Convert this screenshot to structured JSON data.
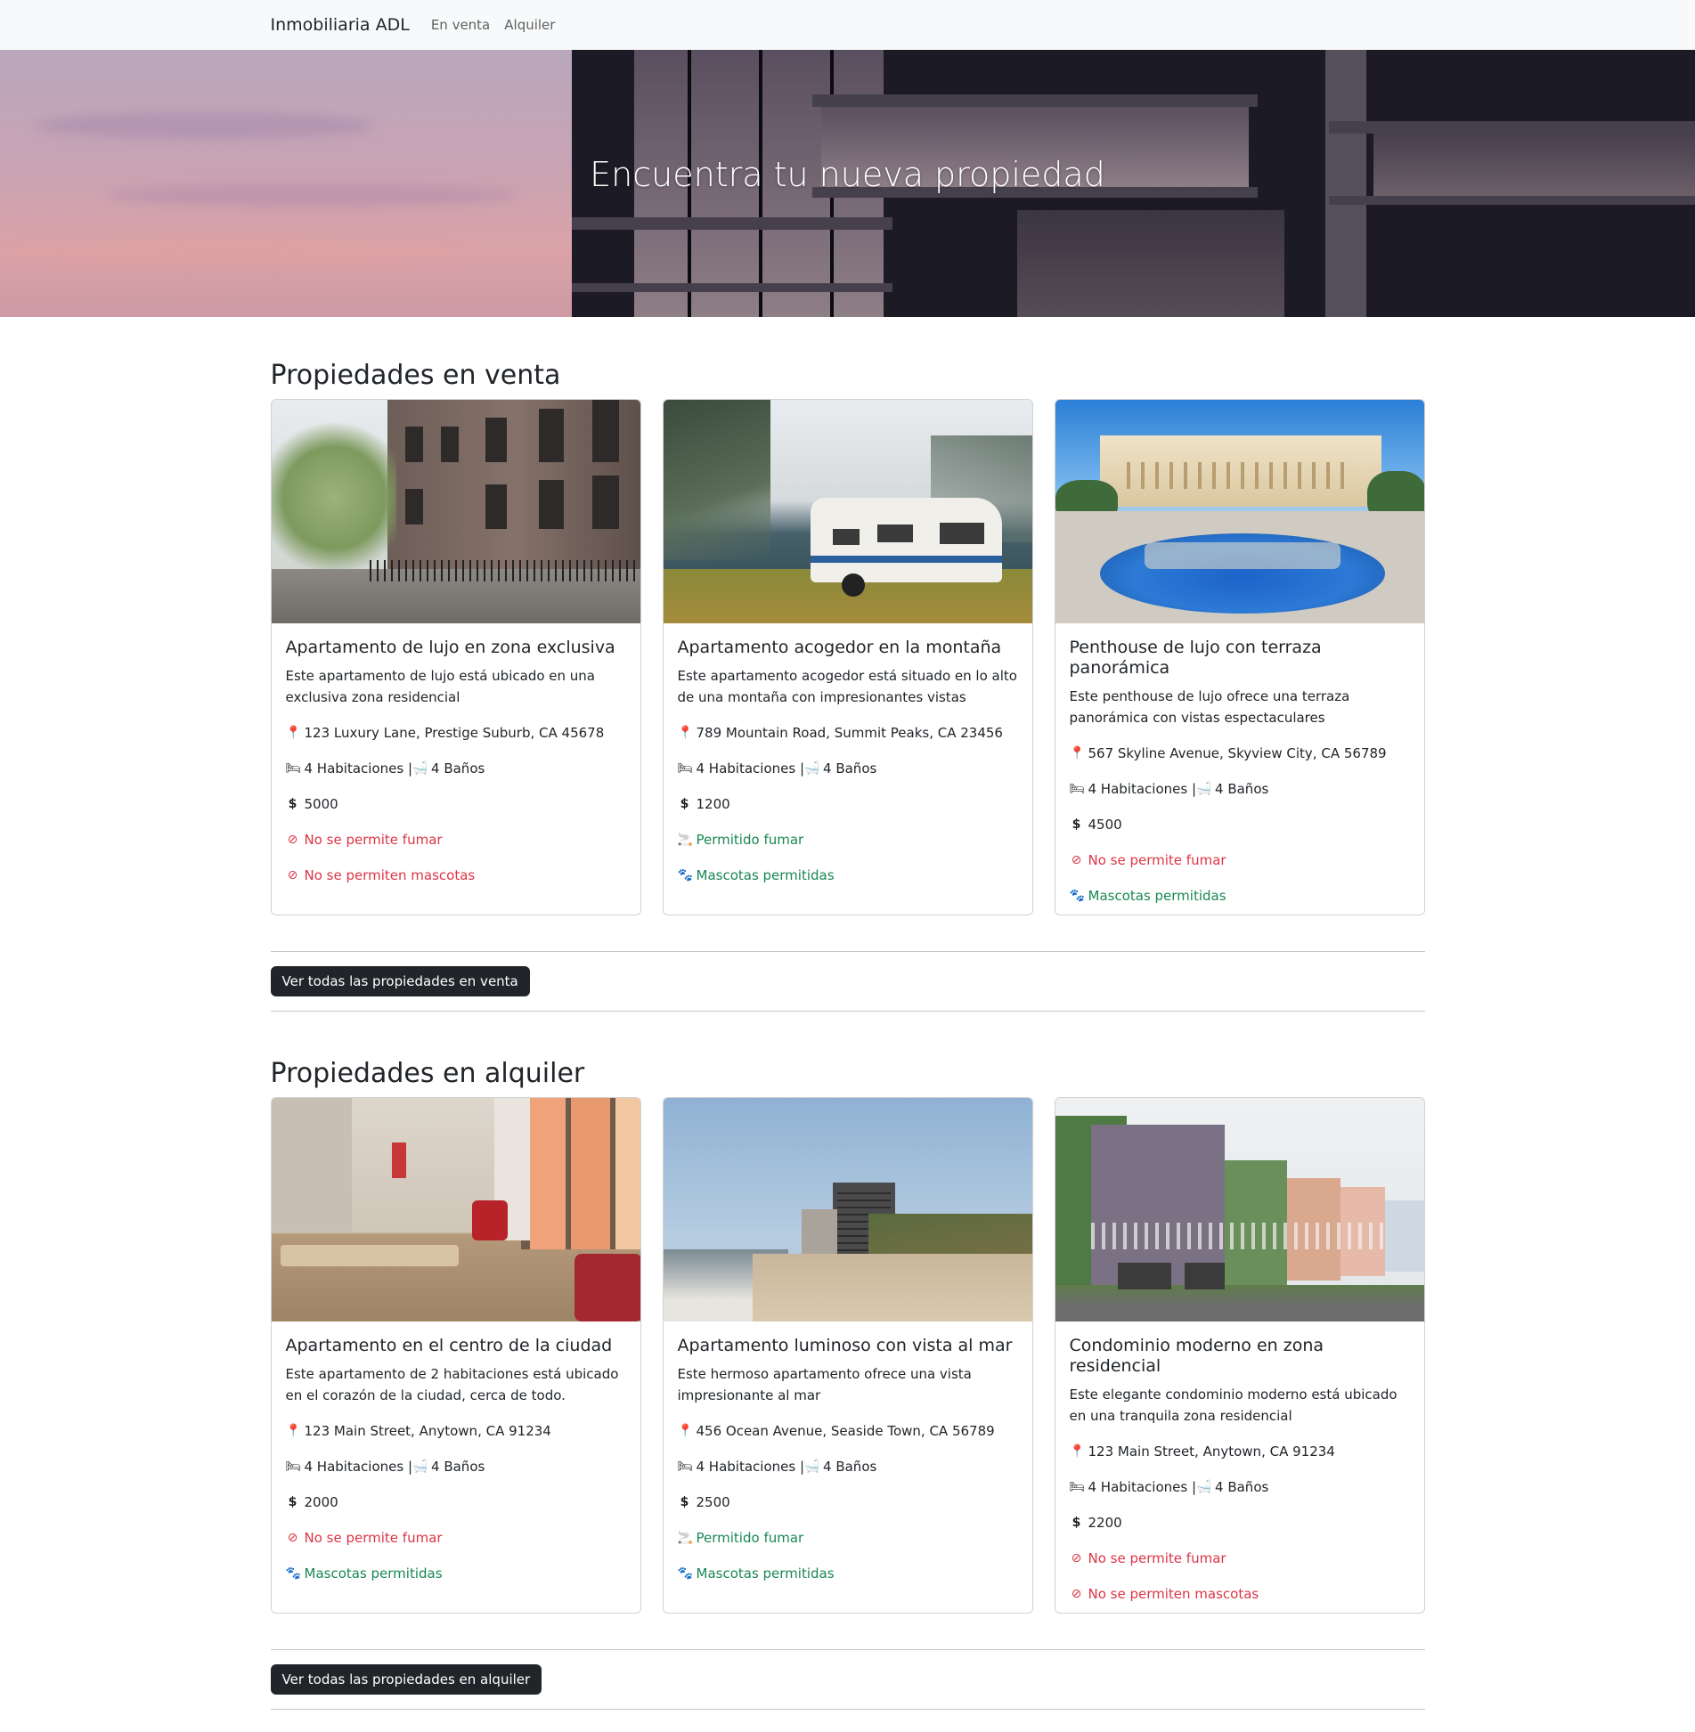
{
  "navbar": {
    "brand": "Inmobiliaria ADL",
    "links": [
      "En venta",
      "Alquiler"
    ]
  },
  "hero": {
    "title": "Encuentra tu nueva propiedad"
  },
  "colors": {
    "danger": "#dc3545",
    "success": "#198754",
    "button_dark": "#212529",
    "navbar_bg": "#f8f9fa"
  },
  "sale": {
    "heading": "Propiedades en venta",
    "button": "Ver todas las propiedades en venta",
    "cards": [
      {
        "title": "Apartamento de lujo en zona exclusiva",
        "description": "Este apartamento de lujo está ubicado en una exclusiva zona residencial",
        "address": "123 Luxury Lane, Prestige Suburb, CA 45678",
        "rooms": "4 Habitaciones | ",
        "baths": "4 Baños",
        "price": "5000",
        "smoking": "No se permite fumar",
        "pets": "No se permiten mascotas",
        "smoking_allowed": false,
        "pets_allowed": false,
        "image_icon": "brownstone-street-photo"
      },
      {
        "title": "Apartamento acogedor en la montaña",
        "description": "Este apartamento acogedor está situado en lo alto de una montaña con impresionantes vistas",
        "address": "789 Mountain Road, Summit Peaks, CA 23456",
        "rooms": "4 Habitaciones | ",
        "baths": "4 Baños",
        "price": "1200",
        "smoking": "Permitido fumar",
        "pets": "Mascotas permitidas",
        "smoking_allowed": true,
        "pets_allowed": true,
        "image_icon": "caravan-fjord-photo"
      },
      {
        "title": "Penthouse de lujo con terraza panorámica",
        "description": "Este penthouse de lujo ofrece una terraza panorámica con vistas espectaculares",
        "address": "567 Skyline Avenue, Skyview City, CA 56789",
        "rooms": "4 Habitaciones | ",
        "baths": "4 Baños",
        "price": "4500",
        "smoking": "No se permite fumar",
        "pets": "Mascotas permitidas",
        "smoking_allowed": false,
        "pets_allowed": true,
        "image_icon": "mansion-pool-photo"
      }
    ]
  },
  "rent": {
    "heading": "Propiedades en alquiler",
    "button": "Ver todas las propiedades en alquiler",
    "cards": [
      {
        "title": "Apartamento en el centro de la ciudad",
        "description": "Este apartamento de 2 habitaciones está ubicado en el corazón de la ciudad, cerca de todo.",
        "address": "123 Main Street, Anytown, CA 91234",
        "rooms": "4 Habitaciones | ",
        "baths": "4 Baños",
        "price": "2000",
        "smoking": "No se permite fumar",
        "pets": "Mascotas permitidas",
        "smoking_allowed": false,
        "pets_allowed": true,
        "image_icon": "living-room-photo"
      },
      {
        "title": "Apartamento luminoso con vista al mar",
        "description": "Este hermoso apartamento ofrece una vista impresionante al mar",
        "address": "456 Ocean Avenue, Seaside Town, CA 56789",
        "rooms": "4 Habitaciones | ",
        "baths": "4 Baños",
        "price": "2500",
        "smoking": "Permitido fumar",
        "pets": "Mascotas permitidas",
        "smoking_allowed": true,
        "pets_allowed": true,
        "image_icon": "beach-tower-photo"
      },
      {
        "title": "Condominio moderno en zona residencial",
        "description": "Este elegante condominio moderno está ubicado en una tranquila zona residencial",
        "address": "123 Main Street, Anytown, CA 91234",
        "rooms": "4 Habitaciones | ",
        "baths": "4 Baños",
        "price": "2200",
        "smoking": "No se permite fumar",
        "pets": "No se permiten mascotas",
        "smoking_allowed": false,
        "pets_allowed": false,
        "image_icon": "row-houses-photo"
      }
    ]
  }
}
